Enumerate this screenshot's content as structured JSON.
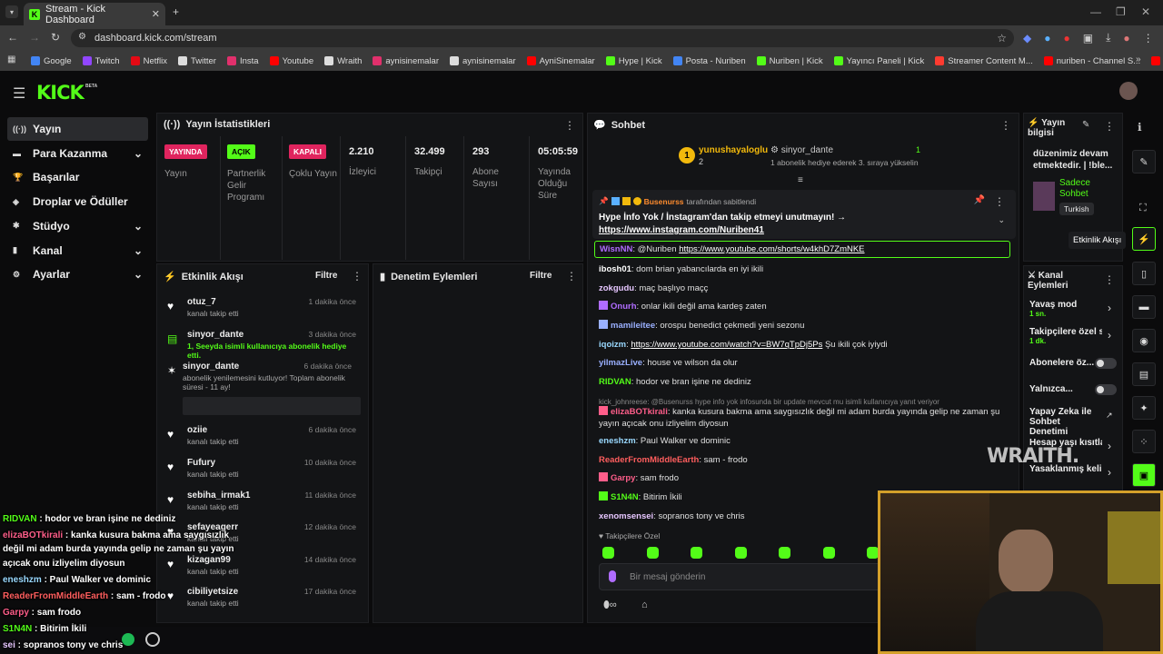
{
  "browser": {
    "tab_title": "Stream - Kick Dashboard",
    "url": "dashboard.kick.com/stream",
    "bookmarks": [
      {
        "label": "Google",
        "color": "#4285f4"
      },
      {
        "label": "Twitch",
        "color": "#9146ff"
      },
      {
        "label": "Netflix",
        "color": "#e50914"
      },
      {
        "label": "Twitter",
        "color": "#dddddd"
      },
      {
        "label": "Insta",
        "color": "#e1306c"
      },
      {
        "label": "Youtube",
        "color": "#ff0000"
      },
      {
        "label": "Wraith",
        "color": "#dddddd"
      },
      {
        "label": "aynisinemalar",
        "color": "#e1306c"
      },
      {
        "label": "aynisinemalar",
        "color": "#dddddd"
      },
      {
        "label": "AyniSinemalar",
        "color": "#ff0000"
      },
      {
        "label": "Hype | Kick",
        "color": "#53fc18"
      },
      {
        "label": "Posta - Nuriben",
        "color": "#4285f4"
      },
      {
        "label": "Nuriben | Kick",
        "color": "#53fc18"
      },
      {
        "label": "Yayıncı Paneli | Kick",
        "color": "#53fc18"
      },
      {
        "label": "Streamer Content M...",
        "color": "#ff3b30"
      },
      {
        "label": "nuriben - Channel S...",
        "color": "#ff0000"
      },
      {
        "label": "Aynı Sinemalar - Ça...",
        "color": "#ff0000"
      }
    ]
  },
  "header": {
    "logo": "KICK",
    "beta": "BETA"
  },
  "sidebar": [
    {
      "label": "Yayın",
      "icon": "broadcast-icon",
      "chevron": false
    },
    {
      "label": "Para Kazanma",
      "icon": "money-icon",
      "chevron": true
    },
    {
      "label": "Başarılar",
      "icon": "trophy-icon",
      "chevron": false
    },
    {
      "label": "Droplar ve Ödüller",
      "icon": "gift-icon",
      "chevron": false
    },
    {
      "label": "Stüdyo",
      "icon": "studio-icon",
      "chevron": true
    },
    {
      "label": "Kanal",
      "icon": "channel-icon",
      "chevron": true
    },
    {
      "label": "Ayarlar",
      "icon": "settings-icon",
      "chevron": true
    }
  ],
  "stats": {
    "title": "Yayın İstatistikleri",
    "badges": [
      {
        "badge": "YAYINDA",
        "label": "Yayın",
        "bg": "#e0245e",
        "fg": "#fff"
      },
      {
        "badge": "AÇIK",
        "label": "Partnerlik Gelir Programı",
        "bg": "#53fc18",
        "fg": "#000"
      },
      {
        "badge": "KAPALI",
        "label": "Çoklu Yayın",
        "bg": "#e0245e",
        "fg": "#fff"
      }
    ],
    "numbers": [
      {
        "value": "2.210",
        "label": "İzleyici"
      },
      {
        "value": "32.499",
        "label": "Takipçi"
      },
      {
        "value": "293",
        "label": "Abone Sayısı"
      },
      {
        "value": "05:05:59",
        "label": "Yayında Olduğu Süre"
      }
    ]
  },
  "activity": {
    "title": "Etkinlik Akışı",
    "filter": "Filtre",
    "items": [
      {
        "name": "otuz_7",
        "time": "1 dakika önce",
        "sub": "kanalı takip etti"
      },
      {
        "name": "sinyor_dante",
        "time": "3 dakika önce",
        "sub": "1, Seeyda isimli kullanıcıya abonelik hediye etti."
      },
      {
        "name": "sinyor_dante",
        "time": "6 dakika önce",
        "sub": "abonelik yenilemesini kutluyor! Toplam abonelik süresi - 11 ay!"
      },
      {
        "name": "oziie",
        "time": "6 dakika önce",
        "sub": "kanalı takip etti"
      },
      {
        "name": "Fufury",
        "time": "10 dakika önce",
        "sub": "kanalı takip etti"
      },
      {
        "name": "sebiha_irmak1",
        "time": "11 dakika önce",
        "sub": "kanalı takip etti"
      },
      {
        "name": "sefayeagerr",
        "time": "12 dakika önce",
        "sub": "kanalı takip etti"
      },
      {
        "name": "kizagan99",
        "time": "14 dakika önce",
        "sub": "kanalı takip etti"
      },
      {
        "name": "cibiliyetsize",
        "time": "17 dakika önce",
        "sub": "kanalı takip etti"
      }
    ]
  },
  "moderation": {
    "title": "Denetim Eylemleri",
    "filter": "Filtre"
  },
  "chat": {
    "title": "Sohbet",
    "leader": {
      "rank": "1",
      "name": "yunushayaloglu",
      "count": "2",
      "other": "sinyor_dante",
      "other_count": "1",
      "note": "1 abonelik hediye ederek 3. sıraya yükselin"
    },
    "pinned": {
      "by": "Busenurss",
      "by_suffix": "tarafından sabitlendi",
      "text": "Hype İnfo Yok / İnstagram'dan takip etmeyi unutmayın! →",
      "link": "https://www.instagram.com/Nuriben41"
    },
    "messages": [
      {
        "user": "WisnNN",
        "color": "#b06cff",
        "text": ": @Nuriben ",
        "link": "https://www.youtube.com/shorts/w4khD7ZmNKE"
      },
      {
        "user": "ibosh01",
        "color": "#ffffff",
        "text": ": dom brian yabancılarda en iyi ikili"
      },
      {
        "user": "zokgudu",
        "color": "#e6c6ff",
        "text": ": maç başlıyo maçç"
      },
      {
        "user": "Onurh",
        "color": "#b06cff",
        "text": ": onlar ikili değil ama kardeş zaten"
      },
      {
        "user": "mamileitee",
        "color": "#9ab0ff",
        "text": ": orospu benedict çekmedi yeni sezonu"
      },
      {
        "user": "iqoizm",
        "color": "#9ad9ff",
        "text": ": ",
        "link": "https://www.youtube.com/watch?v=BW7qTpDj5Ps",
        "after": " Şu ikili çok iyiydi"
      },
      {
        "user": "yilmazLive",
        "color": "#9ab0ff",
        "text": ": house ve wilson da olur"
      },
      {
        "user": "RIDVAN",
        "color": "#53fc18",
        "text": ": hodor ve bran işine ne dediniz"
      },
      {
        "user": "elizaBOTkirali",
        "color": "#ff5e8a",
        "text": ": kanka kusura bakma ama saygısızlık değil mi adam burda yayında gelip ne zaman şu yayın açıcak onu izliyelim diyosun",
        "reply": "kick_johnreese: @Busenurss hype info yok infosunda bir update mevcut mu isimli kullanıcıya yanıt veriyor"
      },
      {
        "user": "eneshzm",
        "color": "#9ad9ff",
        "text": ": Paul Walker ve dominic"
      },
      {
        "user": "ReaderFromMiddleEarth",
        "color": "#ff5e5e",
        "text": ": sam - frodo"
      },
      {
        "user": "Garpy",
        "color": "#ff5e8a",
        "text": ": sam frodo"
      },
      {
        "user": "S1N4N",
        "color": "#53fc18",
        "text": ": Bitirim İkili"
      },
      {
        "user": "xenomsensei",
        "color": "#e6c6ff",
        "text": ": sopranos tony ve chris"
      }
    ],
    "followers_only": "Takipçilere Özel",
    "input_placeholder": "Bir mesaj gönderin"
  },
  "stream_info": {
    "title": "Yayın bilgisi",
    "text": "düzenimiz devam etmektedir. | !ble...",
    "mode": "Sadece Sohbet",
    "lang": "Turkish"
  },
  "channel_actions": {
    "title": "Kanal Eylemleri",
    "items": [
      {
        "label": "Yavaş mod",
        "sub": "1 sn.",
        "control": "chevron"
      },
      {
        "label": "Takipçilere özel s",
        "sub": "1 dk.",
        "control": "chevron"
      },
      {
        "label": "Abonelere öz...",
        "sub": "",
        "control": "toggle"
      },
      {
        "label": "Yalnızca...",
        "sub": "",
        "control": "toggle"
      },
      {
        "label": "Yapay Zeka ile Sohbet Denetimi",
        "sub": "",
        "control": "link"
      },
      {
        "label": "Hesap yaşı kısıtla",
        "sub": "",
        "control": "chevron"
      },
      {
        "label": "Yasaklanmış kelin",
        "sub": "",
        "control": "chevron"
      }
    ]
  },
  "tooltip": "Etkinlik Akışı",
  "watermark": "WRAITH.",
  "overlay_chat": [
    {
      "user": "RIDVAN",
      "color": "#53fc18",
      "text": " : hodor ve bran işine ne dediniz"
    },
    {
      "user": "elizaBOTkirali",
      "color": "#ff5e8a",
      "text": " : kanka kusura bakma ama saygısızlık"
    },
    {
      "user": "",
      "color": "#fff",
      "text": "değil mi adam burda yayında gelip ne zaman şu yayın"
    },
    {
      "user": "",
      "color": "#fff",
      "text": "açıcak onu izliyelim diyosun"
    },
    {
      "user": "eneshzm",
      "color": "#9ad9ff",
      "text": " : Paul Walker ve dominic"
    },
    {
      "user": "ReaderFromMiddleEarth",
      "color": "#ff5e5e",
      "text": " : sam - frodo"
    },
    {
      "user": "Garpy",
      "color": "#ff5e8a",
      "text": " : sam frodo"
    },
    {
      "user": "S1N4N",
      "color": "#53fc18",
      "text": " : Bitirim İkili"
    },
    {
      "user": "sei",
      "color": "#e6c6ff",
      "text": " : sopranos tony ve chris"
    }
  ]
}
